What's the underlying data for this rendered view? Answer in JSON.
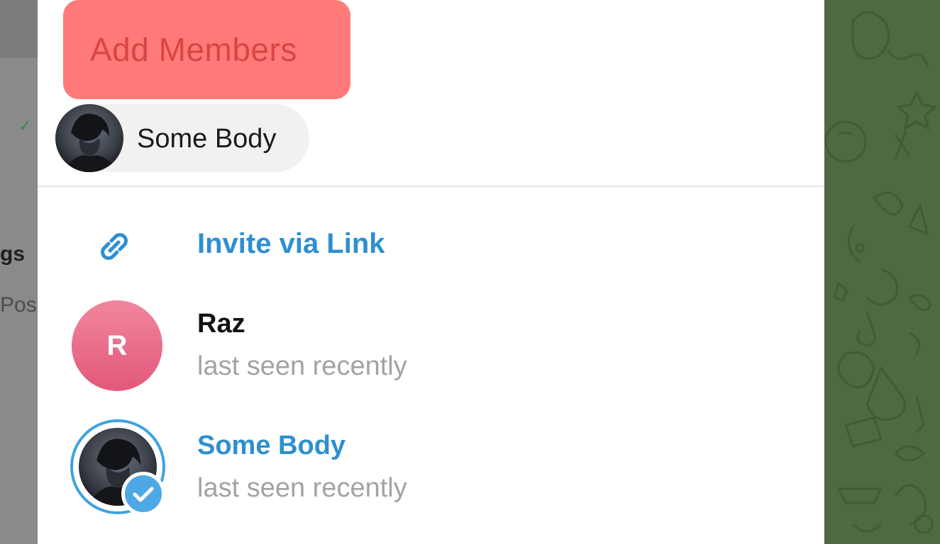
{
  "dialog": {
    "title": "Add Members",
    "selected_chip": {
      "name": "Some Body"
    },
    "invite": {
      "label": "Invite via Link",
      "icon": "link-icon"
    },
    "contacts": [
      {
        "initial": "R",
        "name": "Raz",
        "status": "last seen recently",
        "selected": false
      },
      {
        "name": "Some Body",
        "status": "last seen recently",
        "selected": true
      }
    ]
  },
  "background": {
    "left_fragment_1": "gs",
    "left_fragment_2": "Pos"
  },
  "colors": {
    "accent": "#2e8fd0",
    "title_highlight": "#ff7a78",
    "title_text": "#d94545",
    "status_text": "#a3a3a3",
    "chat_bg": "#4d6a41"
  }
}
